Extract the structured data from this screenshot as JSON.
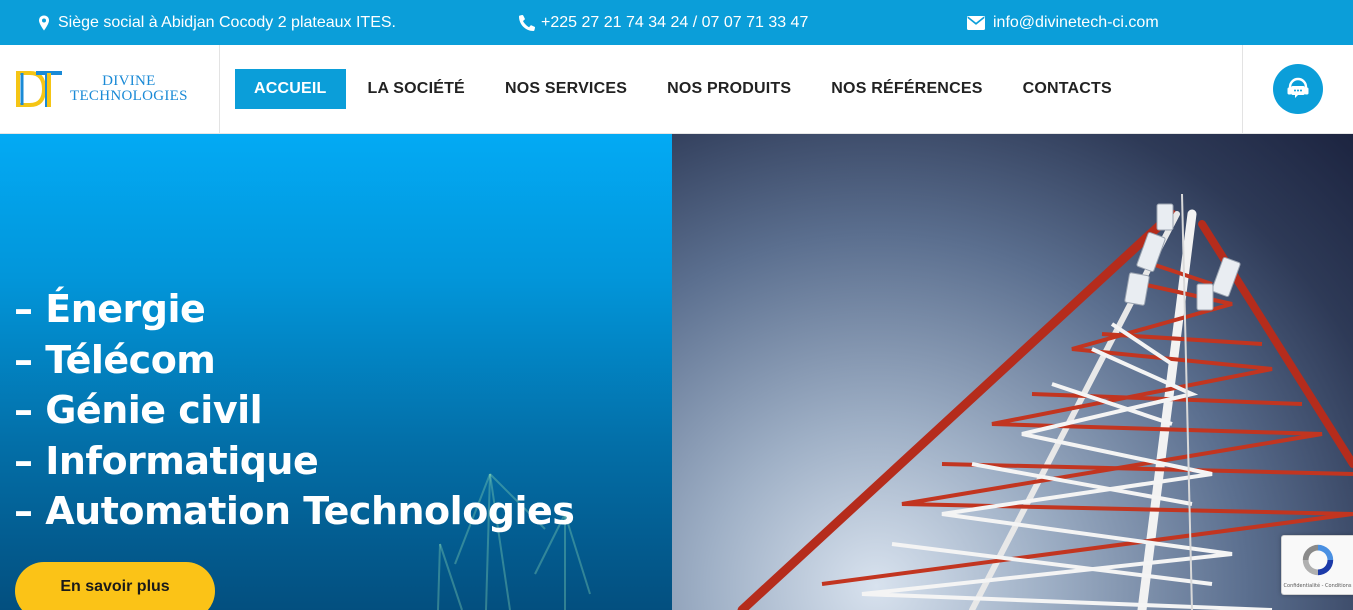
{
  "topbar": {
    "address": "Siège social à Abidjan Cocody 2 plateaux ITES.",
    "phone": "+225 27 21 74 34 24 / 07 07 71 33 47",
    "email": "info@divinetech-ci.com",
    "background": "#0b9ed9"
  },
  "logo": {
    "line1": "DIVINE",
    "line2": "TECHNOLOGIES"
  },
  "nav": {
    "items": [
      {
        "label": "ACCUEIL",
        "active": true
      },
      {
        "label": "LA SOCIÉTÉ"
      },
      {
        "label": "NOS SERVICES"
      },
      {
        "label": "NOS PRODUITS"
      },
      {
        "label": "NOS RÉFÉRENCES"
      },
      {
        "label": "CONTACTS"
      }
    ]
  },
  "hero": {
    "lines": [
      "– Énergie",
      "– Télécom",
      "– Génie civil",
      "– Informatique",
      "– Automation Technologies"
    ],
    "cta": "En savoir plus",
    "cta_color": "#fbc317"
  },
  "recaptcha": {
    "text": "Confidentialité - Conditions"
  }
}
